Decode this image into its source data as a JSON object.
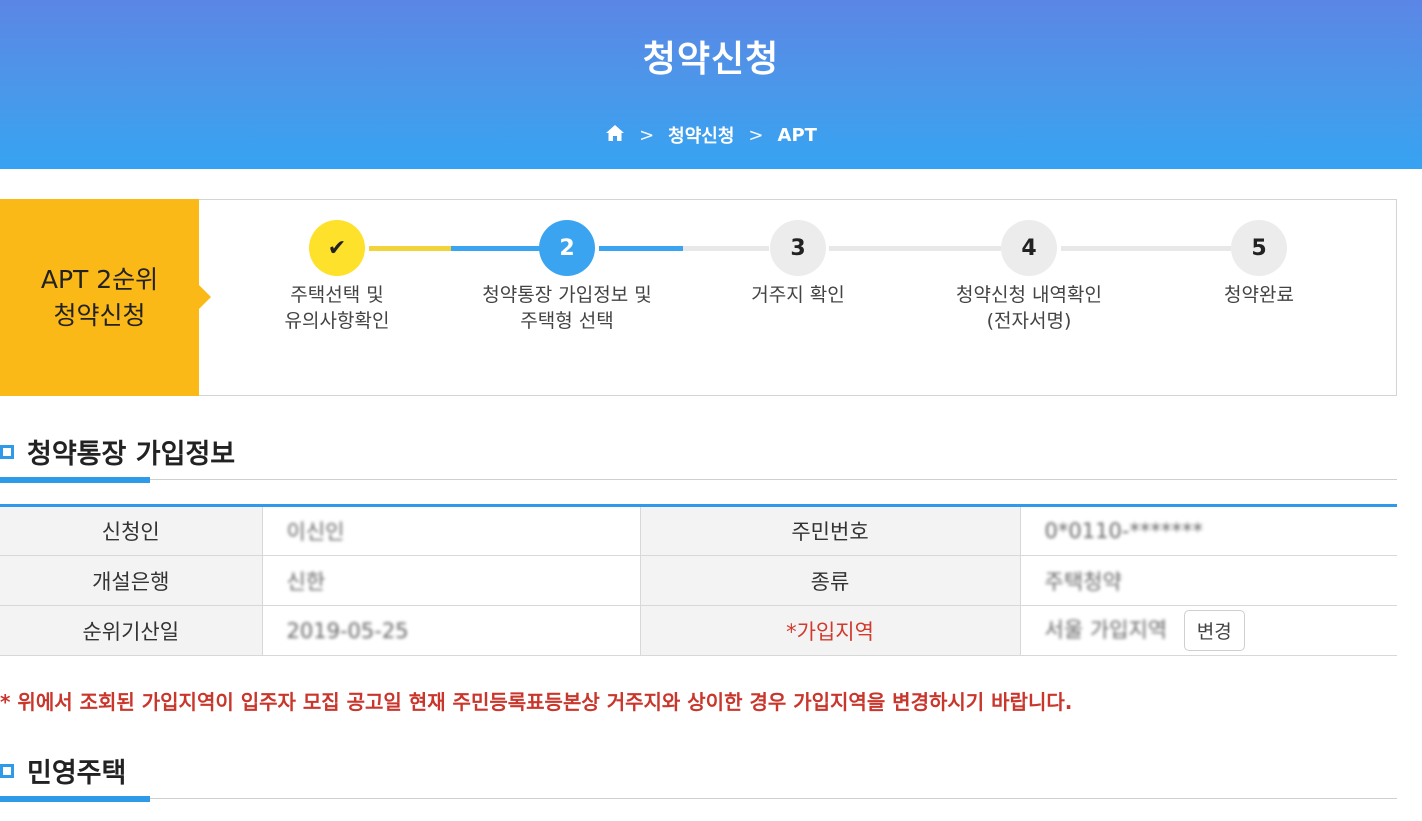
{
  "header": {
    "title": "청약신청",
    "breadcrumb": [
      "청약신청",
      "APT"
    ]
  },
  "steps": {
    "label_line1": "APT 2순위",
    "label_line2": "청약신청",
    "items": [
      {
        "number": "✔",
        "line1": "주택선택 및",
        "line2": "유의사항확인",
        "state": "done"
      },
      {
        "number": "2",
        "line1": "청약통장 가입정보 및",
        "line2": "주택형 선택",
        "state": "active"
      },
      {
        "number": "3",
        "line1": "거주지 확인",
        "line2": "",
        "state": "pending"
      },
      {
        "number": "4",
        "line1": "청약신청 내역확인",
        "line2": "(전자서명)",
        "state": "pending"
      },
      {
        "number": "5",
        "line1": "청약완료",
        "line2": "",
        "state": "pending"
      }
    ]
  },
  "account_section": {
    "title": "청약통장 가입정보",
    "rows": [
      {
        "label1": "신청인",
        "value1": "이신인",
        "label2": "주민번호",
        "value2": "0*0110-*******"
      },
      {
        "label1": "개설은행",
        "value1": "신한",
        "label2": "종류",
        "value2": "주택청약"
      },
      {
        "label1": "순위기산일",
        "value1": "2019-05-25",
        "label2_mark": "*",
        "label2": "가입지역",
        "value2": "서울 가입지역",
        "button": "변경"
      }
    ],
    "notice": "* 위에서 조회된 가입지역이 입주자 모집 공고일 현재 주민등록표등본상 거주지와 상이한 경우 가입지역을 변경하시기 바랍니다."
  },
  "private_section": {
    "title": "민영주택"
  },
  "colors": {
    "primary": "#2f9be8",
    "accent_yellow": "#fbb917",
    "done_circle": "#fde12a",
    "notice_red": "#c9362c"
  }
}
